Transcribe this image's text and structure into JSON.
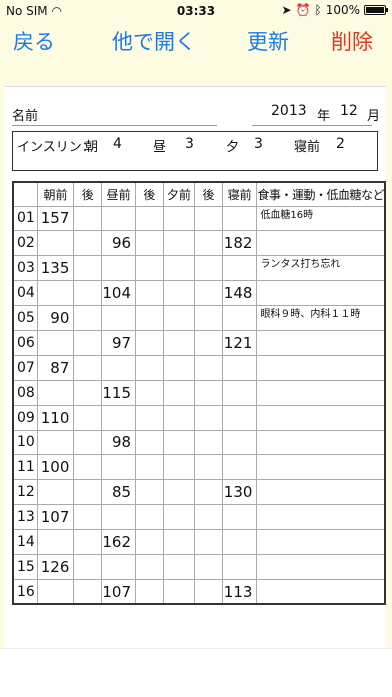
{
  "status": {
    "carrier": "No SIM",
    "time": "03:33",
    "battery": "100%"
  },
  "toolbar": {
    "back": "戻る",
    "open_other": "他で開く",
    "refresh": "更新",
    "delete": "削除"
  },
  "header": {
    "name_label": "名前",
    "year": "2013",
    "year_unit": "年",
    "month": "12",
    "month_unit": "月"
  },
  "insulin": {
    "label": "インスリン：",
    "items": [
      {
        "label": "朝",
        "value": "4"
      },
      {
        "label": "昼",
        "value": "3"
      },
      {
        "label": "夕",
        "value": "3"
      },
      {
        "label": "寝前",
        "value": "2"
      }
    ]
  },
  "table": {
    "columns": [
      "",
      "朝前",
      "後",
      "昼前",
      "後",
      "夕前",
      "後",
      "寝前",
      "食事・運動・低血糖など"
    ],
    "rows": [
      [
        "01",
        "157",
        "",
        "",
        "",
        "",
        "",
        "",
        "低血糖16時"
      ],
      [
        "02",
        "",
        "",
        "96",
        "",
        "",
        "",
        "182",
        ""
      ],
      [
        "03",
        "135",
        "",
        "",
        "",
        "",
        "",
        "",
        "ランタス打ち忘れ"
      ],
      [
        "04",
        "",
        "",
        "104",
        "",
        "",
        "",
        "148",
        ""
      ],
      [
        "05",
        "90",
        "",
        "",
        "",
        "",
        "",
        "",
        "眼科９時、内科１１時"
      ],
      [
        "06",
        "",
        "",
        "97",
        "",
        "",
        "",
        "121",
        ""
      ],
      [
        "07",
        "87",
        "",
        "",
        "",
        "",
        "",
        "",
        ""
      ],
      [
        "08",
        "",
        "",
        "115",
        "",
        "",
        "",
        "",
        ""
      ],
      [
        "09",
        "110",
        "",
        "",
        "",
        "",
        "",
        "",
        ""
      ],
      [
        "10",
        "",
        "",
        "98",
        "",
        "",
        "",
        "",
        ""
      ],
      [
        "11",
        "100",
        "",
        "",
        "",
        "",
        "",
        "",
        ""
      ],
      [
        "12",
        "",
        "",
        "85",
        "",
        "",
        "",
        "130",
        ""
      ],
      [
        "13",
        "107",
        "",
        "",
        "",
        "",
        "",
        "",
        ""
      ],
      [
        "14",
        "",
        "",
        "162",
        "",
        "",
        "",
        "",
        ""
      ],
      [
        "15",
        "126",
        "",
        "",
        "",
        "",
        "",
        "",
        ""
      ],
      [
        "16",
        "",
        "",
        "107",
        "",
        "",
        "",
        "113",
        ""
      ]
    ]
  }
}
